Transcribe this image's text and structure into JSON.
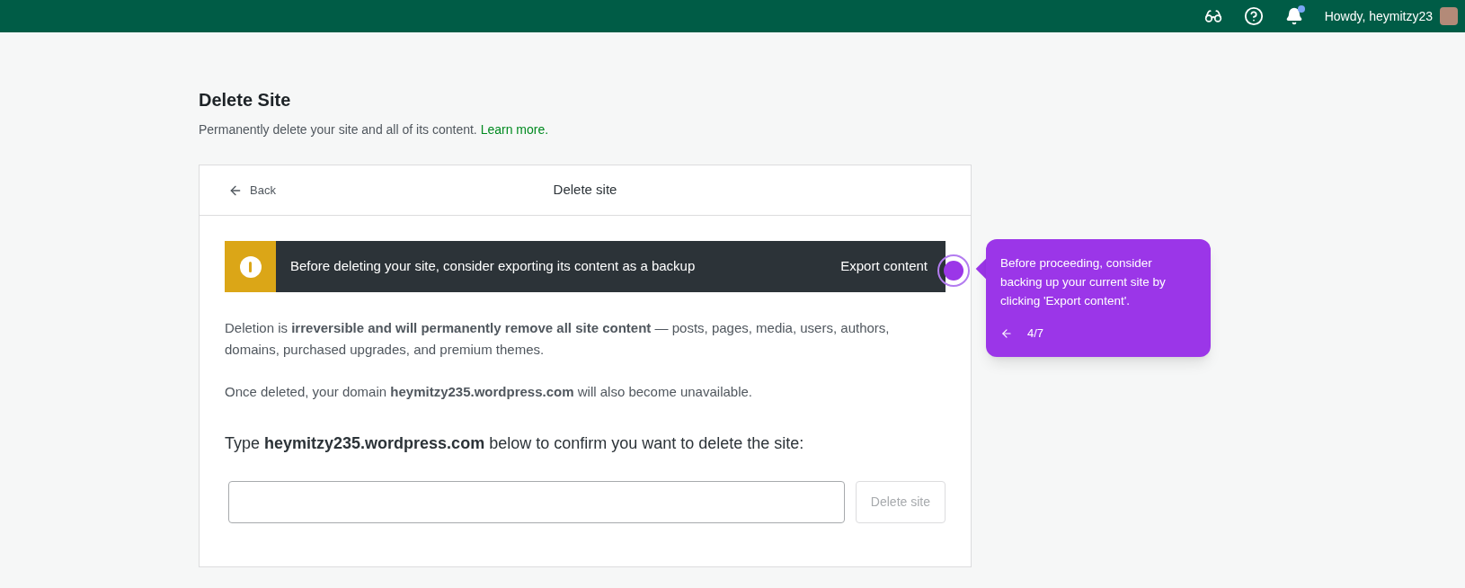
{
  "top_bar": {
    "notifications_unread": true,
    "greeting": "Howdy, heymitzy23"
  },
  "page": {
    "title": "Delete Site",
    "subtitle": "Permanently delete your site and all of its content.",
    "subtitle_link": "Learn more."
  },
  "card": {
    "back": "Back",
    "title": "Delete site",
    "notice": {
      "text": "Before deleting your site, consider exporting its content as a backup",
      "action": "Export content"
    },
    "paragraphs": [
      "Deletion is **irreversible and will permanently remove all site content** — posts, pages, media, users, authors, domains, purchased upgrades, and premium themes.",
      "Once deleted, your domain **heymitzy235.wordpress.com** will also become unavailable."
    ],
    "confirm_label": "Type **heymitzy235.wordpress.com** below to confirm you want to delete the site:",
    "delete_button": {
      "label": "Delete site",
      "disabled": true
    }
  },
  "tour_tooltip": {
    "text": "Before proceeding, consider backing up your current site by clicking 'Export content'.",
    "step": "4/7"
  }
}
